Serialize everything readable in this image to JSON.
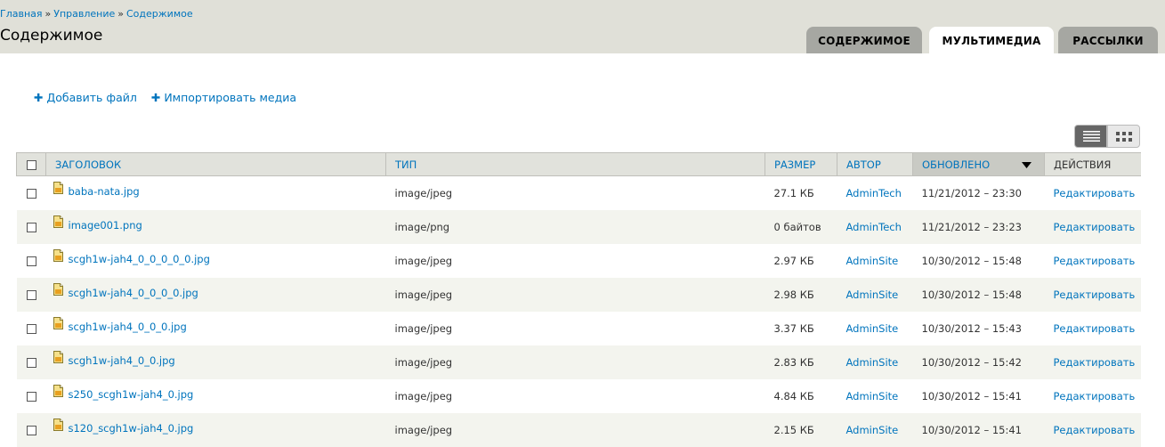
{
  "breadcrumb": [
    "Главная",
    "Управление",
    "Содержимое"
  ],
  "breadcrumb_separator": "»",
  "page_title": "Содержимое",
  "tabs": [
    {
      "label": "СОДЕРЖИМОЕ",
      "active": false
    },
    {
      "label": "МУЛЬТИМЕДИА",
      "active": true
    },
    {
      "label": "РАССЫЛКИ",
      "active": false
    }
  ],
  "actions": [
    {
      "label": "Добавить файл",
      "icon": "plus-icon"
    },
    {
      "label": "Импортировать медиа",
      "icon": "plus-icon"
    }
  ],
  "view_modes": [
    {
      "name": "list",
      "icon": "list-view-icon",
      "active": true
    },
    {
      "name": "grid",
      "icon": "grid-view-icon",
      "active": false
    }
  ],
  "table": {
    "headers": {
      "title": "ЗАГОЛОВОК",
      "type": "ТИП",
      "size": "РАЗМЕР",
      "author": "АВТОР",
      "updated": "ОБНОВЛЕНО",
      "actions": "ДЕЙСТВИЯ"
    },
    "sorted_column": "updated",
    "sort_direction": "desc",
    "rows": [
      {
        "title": "baba-nata.jpg",
        "type": "image/jpeg",
        "size": "27.1 КБ",
        "author": "AdminTech",
        "updated": "11/21/2012 – 23:30",
        "action": "Редактировать"
      },
      {
        "title": "image001.png",
        "type": "image/png",
        "size": "0 байтов",
        "author": "AdminTech",
        "updated": "11/21/2012 – 23:23",
        "action": "Редактировать"
      },
      {
        "title": "scgh1w-jah4_0_0_0_0_0.jpg",
        "type": "image/jpeg",
        "size": "2.97 КБ",
        "author": "AdminSite",
        "updated": "10/30/2012 – 15:48",
        "action": "Редактировать"
      },
      {
        "title": "scgh1w-jah4_0_0_0_0.jpg",
        "type": "image/jpeg",
        "size": "2.98 КБ",
        "author": "AdminSite",
        "updated": "10/30/2012 – 15:48",
        "action": "Редактировать"
      },
      {
        "title": "scgh1w-jah4_0_0_0.jpg",
        "type": "image/jpeg",
        "size": "3.37 КБ",
        "author": "AdminSite",
        "updated": "10/30/2012 – 15:43",
        "action": "Редактировать"
      },
      {
        "title": "scgh1w-jah4_0_0.jpg",
        "type": "image/jpeg",
        "size": "2.83 КБ",
        "author": "AdminSite",
        "updated": "10/30/2012 – 15:42",
        "action": "Редактировать"
      },
      {
        "title": "s250_scgh1w-jah4_0.jpg",
        "type": "image/jpeg",
        "size": "4.84 КБ",
        "author": "AdminSite",
        "updated": "10/30/2012 – 15:41",
        "action": "Редактировать"
      },
      {
        "title": "s120_scgh1w-jah4_0.jpg",
        "type": "image/jpeg",
        "size": "2.15 КБ",
        "author": "AdminSite",
        "updated": "10/30/2012 – 15:41",
        "action": "Редактировать"
      }
    ]
  },
  "colors": {
    "link": "#0074bd",
    "header_bg": "#e0e0d8",
    "tab_inactive": "#a6a7a2",
    "row_even": "#f3f4ee",
    "sorted_header": "#c9cac4"
  }
}
